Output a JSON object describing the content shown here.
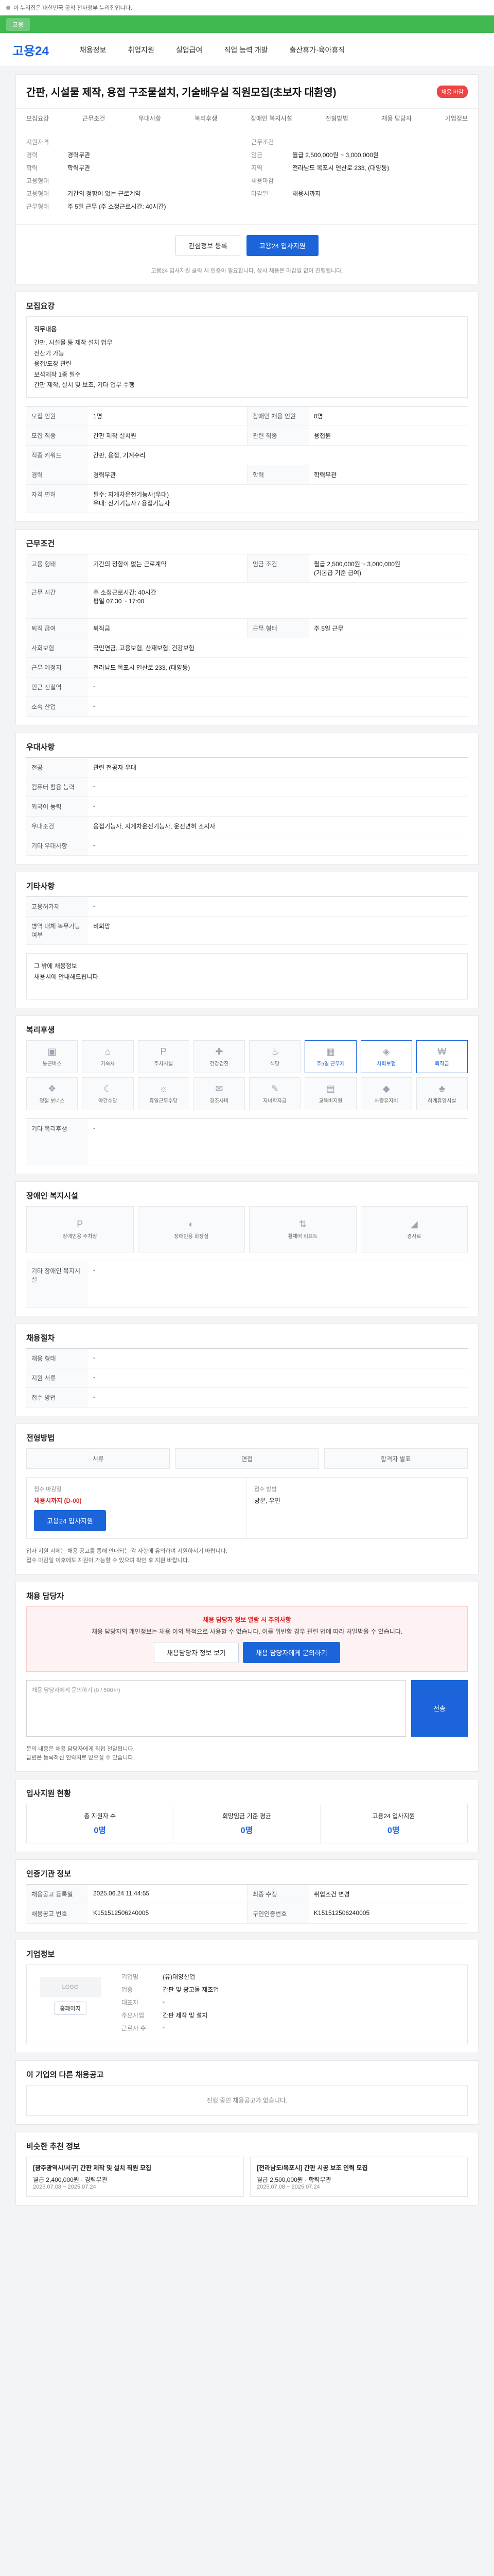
{
  "topbar": {
    "text": "이 누리집은 대한민국 공식 전자정부 누리집입니다."
  },
  "greenbar": {
    "text": "고용"
  },
  "header": {
    "logo": "고용24",
    "nav": [
      "채용정보",
      "취업지원",
      "실업급여",
      "직업 능력 개발",
      "출산휴가·육아휴직"
    ]
  },
  "job": {
    "title": "간판, 시설물 제작, 용접 구조물설치, 기술배우실 직원모집(초보자 대환영)",
    "badge": "채용 마감",
    "tabs": [
      "모집요강",
      "근무조건",
      "우대사항",
      "복리후생",
      "장애인 복지시설",
      "전형방법",
      "채용 담당자",
      "기업정보"
    ],
    "summary_left": [
      {
        "k": "지원자격",
        "v": ""
      },
      {
        "k": "경력",
        "v": "경력무관"
      },
      {
        "k": "학력",
        "v": "학력무관"
      },
      {
        "k": "고용형태",
        "v": ""
      },
      {
        "k": "고용형태",
        "v": "기간의 정함이 없는 근로계약"
      },
      {
        "k": "근무형태",
        "v": "주 5일 근무 (주 소정근로시간: 40시간)"
      }
    ],
    "summary_right": [
      {
        "k": "근무조건",
        "v": ""
      },
      {
        "k": "임금",
        "v": "월급 2,500,000원 ~ 3,000,000원"
      },
      {
        "k": "지역",
        "v": "전라남도 목포시 연산로 233, (대양동)"
      },
      {
        "k": "채용마감",
        "v": ""
      },
      {
        "k": "마감일",
        "v": "채용시까지"
      }
    ],
    "btn_scrap": "관심정보 등록",
    "btn_apply": "고용24 입사지원",
    "note": "고용24 입사지원 클릭 시 인증이 필요합니다. 상시 채용은 마감일 없이 진행됩니다."
  },
  "sections": {
    "recruit": {
      "title": "모집요강",
      "duty_label": "직무내용",
      "duty": "간판, 시설물 등 제작 설치 업무\n전산기 가능\n용접/도장 관련\n보석제작 1종 필수\n간판 제작, 설치 및 보조, 기타 업무 수행",
      "rows": [
        {
          "k": "모집 인원",
          "v": "1명",
          "k2": "장애인 채용 인원",
          "v2": "0명"
        },
        {
          "k": "모집 직종",
          "v": "간판 제작 설치원",
          "k2": "관련 직종",
          "v2": "용접원"
        },
        {
          "k": "직종 키워드",
          "v": "간판, 용접, 기계수리",
          "k2": "",
          "v2": ""
        },
        {
          "k": "경력",
          "v": "경력무관",
          "k2": "학력",
          "v2": "학력무관"
        },
        {
          "k": "자격 면허",
          "v": "필수: 지게차운전기능사(우대)\n우대: 전기기능사 / 용접기능사",
          "k2": "",
          "v2": ""
        }
      ]
    },
    "work": {
      "title": "근무조건",
      "rows": [
        {
          "k": "고용 형태",
          "v": "기간의 정함이 없는 근로계약",
          "k2": "임금 조건",
          "v2": "월급 2,500,000원 ~ 3,000,000원\n(기본급 기준 급여)"
        },
        {
          "k": "근무 시간",
          "v": "주 소정근로시간: 40시간\n평일 07:30 ~ 17:00",
          "k2": "",
          "v2": ""
        },
        {
          "k": "퇴직 급여",
          "v": "퇴직금",
          "k2": "근무 형태",
          "v2": "주 5일 근무"
        },
        {
          "k": "사회보험",
          "v": "국민연금, 고용보험, 산재보험, 건강보험",
          "k2": "",
          "v2": ""
        },
        {
          "k": "근무 예정지",
          "v": "전라남도 목포시 연산로 233, (대양동)",
          "k2": "",
          "v2": ""
        },
        {
          "k": "인근 전철역",
          "v": "-",
          "k2": "",
          "v2": ""
        },
        {
          "k": "소속 산업",
          "v": "-",
          "k2": "",
          "v2": ""
        }
      ]
    },
    "prefer": {
      "title": "우대사항",
      "rows": [
        {
          "k": "전공",
          "v": "관련 전공자 우대"
        },
        {
          "k": "컴퓨터 활용 능력",
          "v": "-"
        },
        {
          "k": "외국어 능력",
          "v": "-"
        },
        {
          "k": "우대조건",
          "v": "용접기능사, 지게차운전기능사, 운전면허 소지자"
        },
        {
          "k": "기타 우대사항",
          "v": "-"
        }
      ]
    },
    "etc": {
      "title": "기타사항",
      "rows": [
        {
          "k": "고용허가제",
          "v": "-"
        },
        {
          "k": "병역 대체 복무가능 여부",
          "v": "비희망"
        }
      ],
      "body": "그 밖에 채용정보\n채용시에 안내해드립니다."
    },
    "welfare": {
      "title": "복리후생",
      "items": [
        "통근버스",
        "기숙사",
        "주차시설",
        "건강검진",
        "식당",
        "주5일 근무제",
        "사회보험",
        "퇴직금",
        "명절 보너스",
        "야간수당",
        "휴일근무수당",
        "경조사비",
        "자녀학자금",
        "교육비지원",
        "차량유지비",
        "하계휴양시설"
      ],
      "extra_label": "기타 복리후생",
      "extra": "-"
    },
    "disabled": {
      "title": "장애인 복지시설",
      "items": [
        "장애인용 주차장",
        "장애인용 화장실",
        "휠체어 리프트",
        "경사로"
      ],
      "extra_label": "기타 장애인 복지시설",
      "extra": "-"
    },
    "hire": {
      "title": "채용절차",
      "rows": [
        {
          "k": "채용 형태",
          "v": "-"
        },
        {
          "k": "지원 서류",
          "v": "-"
        },
        {
          "k": "접수 방법",
          "v": "-"
        }
      ]
    },
    "process": {
      "title": "전형방법",
      "steps": [
        "서류",
        "면접",
        "합격자 발표"
      ],
      "apply_label": "접수 마감일",
      "apply_value": "채용시까지 (D-00)",
      "apply_btn": "고용24 입사지원",
      "method_label": "접수 방법",
      "method_value": "방문, 우편",
      "notes": [
        "입사 지원 시에는 채용 공고를 통해 안내되는 각 사항에 유의하여 지원하시기 바랍니다.",
        "접수 마감일 이후에도 지원이 가능할 수 있으며 확인 후 지원 바랍니다."
      ]
    },
    "contact": {
      "title": "채용 담당자",
      "alert_title": "채용 담당자 정보 열람 시 주의사항",
      "alert_body": "채용 담당자의 개인정보는 채용 이외 목적으로 사용할 수 없습니다. 이를 위반할 경우 관련 법에 따라 처벌받을 수 있습니다.",
      "btn_view": "채용담당자 정보 보기",
      "btn_inquiry": "채용 담당자에게 문의하기",
      "inquiry_placeholder": "채용 담당자에게 문의하기 (0 / 500자)",
      "send": "전송",
      "notes": [
        "문의 내용은 채용 담당자에게 직접 전달됩니다.",
        "답변은 등록하신 연락처로 받으실 수 있습니다."
      ]
    },
    "stats": {
      "title": "입사지원 현황",
      "items": [
        {
          "label": "총 지원자 수",
          "value": "0명"
        },
        {
          "label": "희망임금 기준 평균",
          "value": "0명"
        },
        {
          "label": "고용24 입사지원",
          "value": "0명"
        }
      ]
    },
    "info": {
      "title": "인증기관 정보",
      "rows": [
        {
          "k": "채용공고 등록일",
          "v": "2025.06.24 11:44:55",
          "k2": "최종 수정",
          "v2": "취업조건 변경"
        },
        {
          "k": "채용공고 번호",
          "v": "K151512506240005",
          "k2": "구인인증번호",
          "v2": "K151512506240005"
        }
      ]
    },
    "company": {
      "title": "기업정보",
      "logo_text": "LOGO",
      "btn_web": "홈페이지",
      "rows": [
        {
          "k": "기업명",
          "v": "(유)대양산업"
        },
        {
          "k": "업종",
          "v": "간판 및 광고물 제조업"
        },
        {
          "k": "대표자",
          "v": "-"
        },
        {
          "k": "주요사업",
          "v": "간판 제작 및 설치"
        },
        {
          "k": "근로자 수",
          "v": "-"
        }
      ]
    },
    "others": {
      "title": "이 기업의 다른 채용공고",
      "empty": "진행 중인 채용공고가 없습니다."
    },
    "similar": {
      "title": "비슷한 추천 정보",
      "items": [
        {
          "t": "[광주광역시/서구] 간판 제작 및 설치 직원 모집",
          "sub": "월급 2,400,000원 · 경력무관",
          "date": "2025.07.08 ~ 2025.07.24"
        },
        {
          "t": "[전라남도/목포시] 간판 시공 보조 인력 모집",
          "sub": "월급 2,500,000원 · 학력무관",
          "date": "2025.07.08 ~ 2025.07.24"
        }
      ]
    }
  }
}
